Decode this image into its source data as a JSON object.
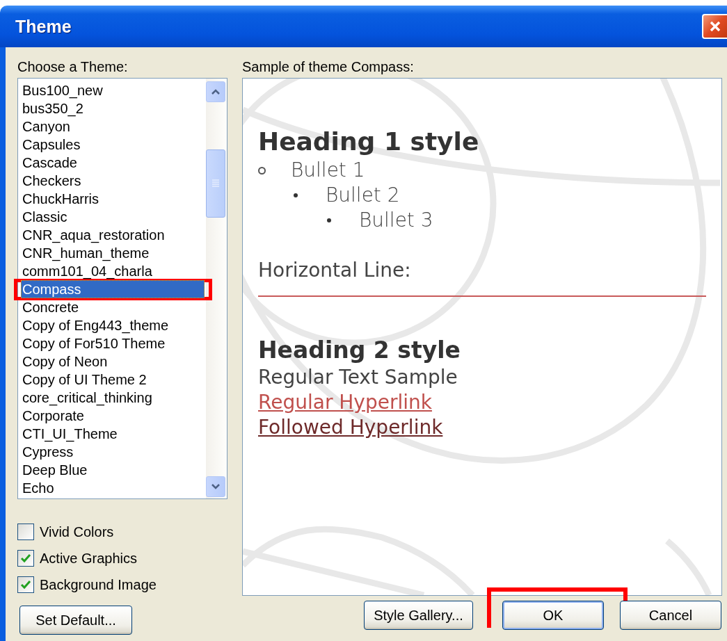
{
  "window": {
    "title": "Theme"
  },
  "theme_list": {
    "label": "Choose a Theme:",
    "items": [
      {
        "name": "Bus100_new",
        "selected": false,
        "highlighted": false
      },
      {
        "name": "bus350_2",
        "selected": false,
        "highlighted": false
      },
      {
        "name": "Canyon",
        "selected": false,
        "highlighted": false
      },
      {
        "name": "Capsules",
        "selected": false,
        "highlighted": false
      },
      {
        "name": "Cascade",
        "selected": false,
        "highlighted": false
      },
      {
        "name": "Checkers",
        "selected": false,
        "highlighted": false
      },
      {
        "name": "ChuckHarris",
        "selected": false,
        "highlighted": false
      },
      {
        "name": "Classic",
        "selected": false,
        "highlighted": false
      },
      {
        "name": "CNR_aqua_restoration",
        "selected": false,
        "highlighted": false
      },
      {
        "name": "CNR_human_theme",
        "selected": false,
        "highlighted": false
      },
      {
        "name": "comm101_04_charla",
        "selected": false,
        "highlighted": false
      },
      {
        "name": "Compass",
        "selected": true,
        "highlighted": true
      },
      {
        "name": "Concrete",
        "selected": false,
        "highlighted": false
      },
      {
        "name": "Copy of Eng443_theme",
        "selected": false,
        "highlighted": false
      },
      {
        "name": "Copy of For510 Theme",
        "selected": false,
        "highlighted": false
      },
      {
        "name": "Copy of Neon",
        "selected": false,
        "highlighted": false
      },
      {
        "name": "Copy of UI Theme 2",
        "selected": false,
        "highlighted": false
      },
      {
        "name": "core_critical_thinking",
        "selected": false,
        "highlighted": false
      },
      {
        "name": "Corporate",
        "selected": false,
        "highlighted": false
      },
      {
        "name": "CTI_UI_Theme",
        "selected": false,
        "highlighted": false
      },
      {
        "name": "Cypress",
        "selected": false,
        "highlighted": false
      },
      {
        "name": "Deep Blue",
        "selected": false,
        "highlighted": false
      },
      {
        "name": "Echo",
        "selected": false,
        "highlighted": false
      }
    ]
  },
  "options": [
    {
      "label": "Vivid Colors",
      "checked": false
    },
    {
      "label": "Active Graphics",
      "checked": true
    },
    {
      "label": "Background Image",
      "checked": true
    }
  ],
  "set_default_button": {
    "label": "Set Default..."
  },
  "preview": {
    "label": "Sample of theme Compass:",
    "heading_1": "Heading 1 style",
    "bullets": [
      {
        "text": "Bullet 1",
        "children": [
          {
            "text": "Bullet 2",
            "children": [
              {
                "text": "Bullet 3"
              }
            ]
          }
        ]
      }
    ],
    "line_label": "Horizontal Line:",
    "heading_2": "Heading 2 style",
    "regular_text": "Regular Text Sample",
    "hyperlink": "Regular Hyperlink",
    "followed_hyperlink": "Followed Hyperlink"
  },
  "buttons": [
    {
      "label": "Style Gallery...",
      "highlighted": false
    },
    {
      "label": "OK",
      "highlighted": true
    },
    {
      "label": "Cancel",
      "highlighted": false
    }
  ]
}
